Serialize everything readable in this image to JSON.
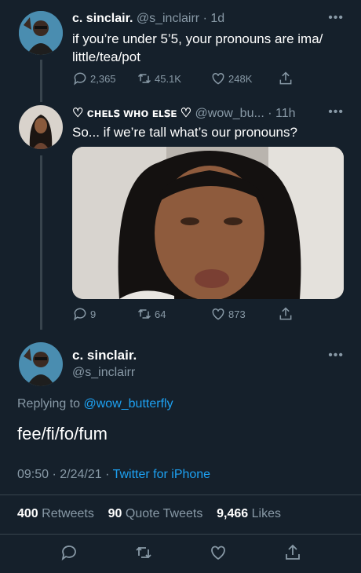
{
  "tweet1": {
    "name": "c. sinclair.",
    "handle": "@s_inclairr",
    "time": "· 1d",
    "text_line1": "if you’re under 5’5, your pronouns are ima/",
    "text_line2": "little/tea/pot",
    "replies": "2,365",
    "retweets": "45.1K",
    "likes": "248K"
  },
  "tweet2": {
    "name": "♡ ᴄʜᴇʟꜱ ᴡʜᴏ ᴇʟꜱᴇ ♡",
    "handle": "@wow_bu...",
    "time": "· 11h",
    "text": "So... if we’re tall what’s our pronouns?",
    "replies": "9",
    "retweets": "64",
    "likes": "873"
  },
  "main_tweet": {
    "name": "c. sinclair.",
    "handle": "@s_inclairr",
    "replying_prefix": "Replying to",
    "replying_to": "@wow_butterfly",
    "text": "fee/fi/fo/fum",
    "timestamp": "09:50 · 2/24/21 ·",
    "source": "Twitter for iPhone",
    "retweet_count": "400",
    "retweet_label": "Retweets",
    "quote_count": "90",
    "quote_label": "Quote Tweets",
    "like_count": "9,466",
    "like_label": "Likes"
  },
  "more_glyph": "•••",
  "icons": [
    "reply-icon",
    "retweet-icon",
    "like-icon",
    "share-icon"
  ],
  "colors": {
    "background": "#15202b",
    "muted": "#8899a6",
    "link": "#1da1f2",
    "divider": "#38444d"
  }
}
